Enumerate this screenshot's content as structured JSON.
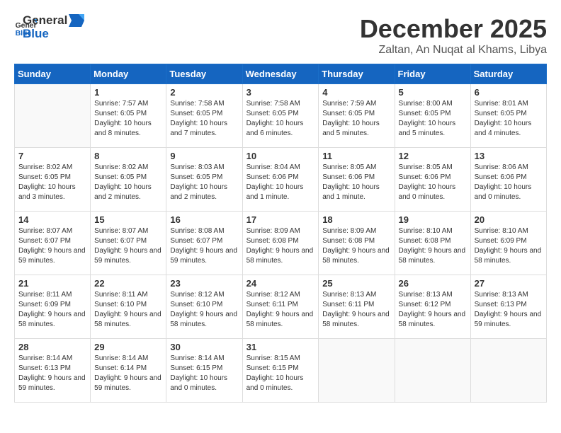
{
  "header": {
    "logo_general": "General",
    "logo_blue": "Blue",
    "month": "December 2025",
    "location": "Zaltan, An Nuqat al Khams, Libya"
  },
  "weekdays": [
    "Sunday",
    "Monday",
    "Tuesday",
    "Wednesday",
    "Thursday",
    "Friday",
    "Saturday"
  ],
  "weeks": [
    [
      {
        "day": "",
        "sunrise": "",
        "sunset": "",
        "daylight": ""
      },
      {
        "day": "1",
        "sunrise": "Sunrise: 7:57 AM",
        "sunset": "Sunset: 6:05 PM",
        "daylight": "Daylight: 10 hours and 8 minutes."
      },
      {
        "day": "2",
        "sunrise": "Sunrise: 7:58 AM",
        "sunset": "Sunset: 6:05 PM",
        "daylight": "Daylight: 10 hours and 7 minutes."
      },
      {
        "day": "3",
        "sunrise": "Sunrise: 7:58 AM",
        "sunset": "Sunset: 6:05 PM",
        "daylight": "Daylight: 10 hours and 6 minutes."
      },
      {
        "day": "4",
        "sunrise": "Sunrise: 7:59 AM",
        "sunset": "Sunset: 6:05 PM",
        "daylight": "Daylight: 10 hours and 5 minutes."
      },
      {
        "day": "5",
        "sunrise": "Sunrise: 8:00 AM",
        "sunset": "Sunset: 6:05 PM",
        "daylight": "Daylight: 10 hours and 5 minutes."
      },
      {
        "day": "6",
        "sunrise": "Sunrise: 8:01 AM",
        "sunset": "Sunset: 6:05 PM",
        "daylight": "Daylight: 10 hours and 4 minutes."
      }
    ],
    [
      {
        "day": "7",
        "sunrise": "Sunrise: 8:02 AM",
        "sunset": "Sunset: 6:05 PM",
        "daylight": "Daylight: 10 hours and 3 minutes."
      },
      {
        "day": "8",
        "sunrise": "Sunrise: 8:02 AM",
        "sunset": "Sunset: 6:05 PM",
        "daylight": "Daylight: 10 hours and 2 minutes."
      },
      {
        "day": "9",
        "sunrise": "Sunrise: 8:03 AM",
        "sunset": "Sunset: 6:05 PM",
        "daylight": "Daylight: 10 hours and 2 minutes."
      },
      {
        "day": "10",
        "sunrise": "Sunrise: 8:04 AM",
        "sunset": "Sunset: 6:06 PM",
        "daylight": "Daylight: 10 hours and 1 minute."
      },
      {
        "day": "11",
        "sunrise": "Sunrise: 8:05 AM",
        "sunset": "Sunset: 6:06 PM",
        "daylight": "Daylight: 10 hours and 1 minute."
      },
      {
        "day": "12",
        "sunrise": "Sunrise: 8:05 AM",
        "sunset": "Sunset: 6:06 PM",
        "daylight": "Daylight: 10 hours and 0 minutes."
      },
      {
        "day": "13",
        "sunrise": "Sunrise: 8:06 AM",
        "sunset": "Sunset: 6:06 PM",
        "daylight": "Daylight: 10 hours and 0 minutes."
      }
    ],
    [
      {
        "day": "14",
        "sunrise": "Sunrise: 8:07 AM",
        "sunset": "Sunset: 6:07 PM",
        "daylight": "Daylight: 9 hours and 59 minutes."
      },
      {
        "day": "15",
        "sunrise": "Sunrise: 8:07 AM",
        "sunset": "Sunset: 6:07 PM",
        "daylight": "Daylight: 9 hours and 59 minutes."
      },
      {
        "day": "16",
        "sunrise": "Sunrise: 8:08 AM",
        "sunset": "Sunset: 6:07 PM",
        "daylight": "Daylight: 9 hours and 59 minutes."
      },
      {
        "day": "17",
        "sunrise": "Sunrise: 8:09 AM",
        "sunset": "Sunset: 6:08 PM",
        "daylight": "Daylight: 9 hours and 58 minutes."
      },
      {
        "day": "18",
        "sunrise": "Sunrise: 8:09 AM",
        "sunset": "Sunset: 6:08 PM",
        "daylight": "Daylight: 9 hours and 58 minutes."
      },
      {
        "day": "19",
        "sunrise": "Sunrise: 8:10 AM",
        "sunset": "Sunset: 6:08 PM",
        "daylight": "Daylight: 9 hours and 58 minutes."
      },
      {
        "day": "20",
        "sunrise": "Sunrise: 8:10 AM",
        "sunset": "Sunset: 6:09 PM",
        "daylight": "Daylight: 9 hours and 58 minutes."
      }
    ],
    [
      {
        "day": "21",
        "sunrise": "Sunrise: 8:11 AM",
        "sunset": "Sunset: 6:09 PM",
        "daylight": "Daylight: 9 hours and 58 minutes."
      },
      {
        "day": "22",
        "sunrise": "Sunrise: 8:11 AM",
        "sunset": "Sunset: 6:10 PM",
        "daylight": "Daylight: 9 hours and 58 minutes."
      },
      {
        "day": "23",
        "sunrise": "Sunrise: 8:12 AM",
        "sunset": "Sunset: 6:10 PM",
        "daylight": "Daylight: 9 hours and 58 minutes."
      },
      {
        "day": "24",
        "sunrise": "Sunrise: 8:12 AM",
        "sunset": "Sunset: 6:11 PM",
        "daylight": "Daylight: 9 hours and 58 minutes."
      },
      {
        "day": "25",
        "sunrise": "Sunrise: 8:13 AM",
        "sunset": "Sunset: 6:11 PM",
        "daylight": "Daylight: 9 hours and 58 minutes."
      },
      {
        "day": "26",
        "sunrise": "Sunrise: 8:13 AM",
        "sunset": "Sunset: 6:12 PM",
        "daylight": "Daylight: 9 hours and 58 minutes."
      },
      {
        "day": "27",
        "sunrise": "Sunrise: 8:13 AM",
        "sunset": "Sunset: 6:13 PM",
        "daylight": "Daylight: 9 hours and 59 minutes."
      }
    ],
    [
      {
        "day": "28",
        "sunrise": "Sunrise: 8:14 AM",
        "sunset": "Sunset: 6:13 PM",
        "daylight": "Daylight: 9 hours and 59 minutes."
      },
      {
        "day": "29",
        "sunrise": "Sunrise: 8:14 AM",
        "sunset": "Sunset: 6:14 PM",
        "daylight": "Daylight: 9 hours and 59 minutes."
      },
      {
        "day": "30",
        "sunrise": "Sunrise: 8:14 AM",
        "sunset": "Sunset: 6:15 PM",
        "daylight": "Daylight: 10 hours and 0 minutes."
      },
      {
        "day": "31",
        "sunrise": "Sunrise: 8:15 AM",
        "sunset": "Sunset: 6:15 PM",
        "daylight": "Daylight: 10 hours and 0 minutes."
      },
      {
        "day": "",
        "sunrise": "",
        "sunset": "",
        "daylight": ""
      },
      {
        "day": "",
        "sunrise": "",
        "sunset": "",
        "daylight": ""
      },
      {
        "day": "",
        "sunrise": "",
        "sunset": "",
        "daylight": ""
      }
    ]
  ]
}
